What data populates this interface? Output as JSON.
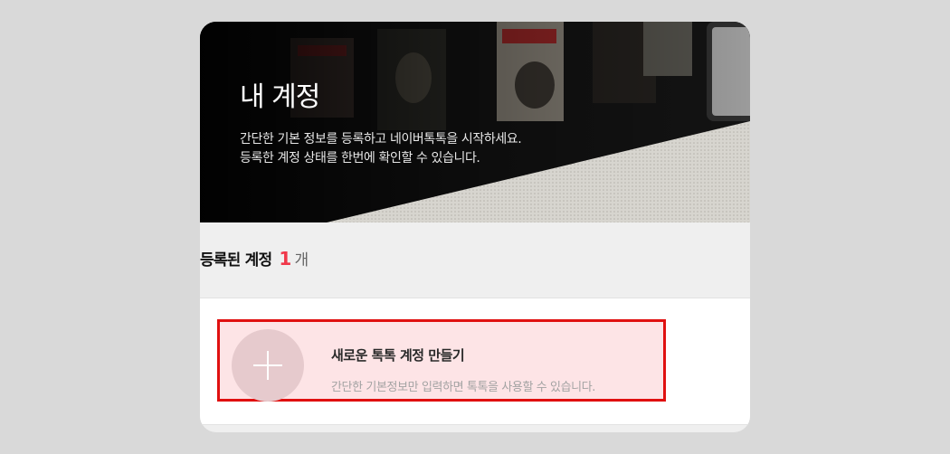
{
  "hero": {
    "title": "내 계정",
    "desc_line1": "간단한 기본 정보를  등록하고 네이버톡톡을 시작하세요.",
    "desc_line2": "등록한 계정 상태를 한번에 확인할 수 있습니다."
  },
  "accounts": {
    "label": "등록된 계정",
    "count": "1",
    "unit": "개"
  },
  "create_account": {
    "title": "새로운 톡톡 계정 만들기",
    "description": "간단한 기본정보만 입력하면 톡톡을 사용할 수 있습니다."
  },
  "colors": {
    "accent": "#f0384a",
    "highlight_border": "#e01010",
    "highlight_fill": "#fde4e6"
  }
}
